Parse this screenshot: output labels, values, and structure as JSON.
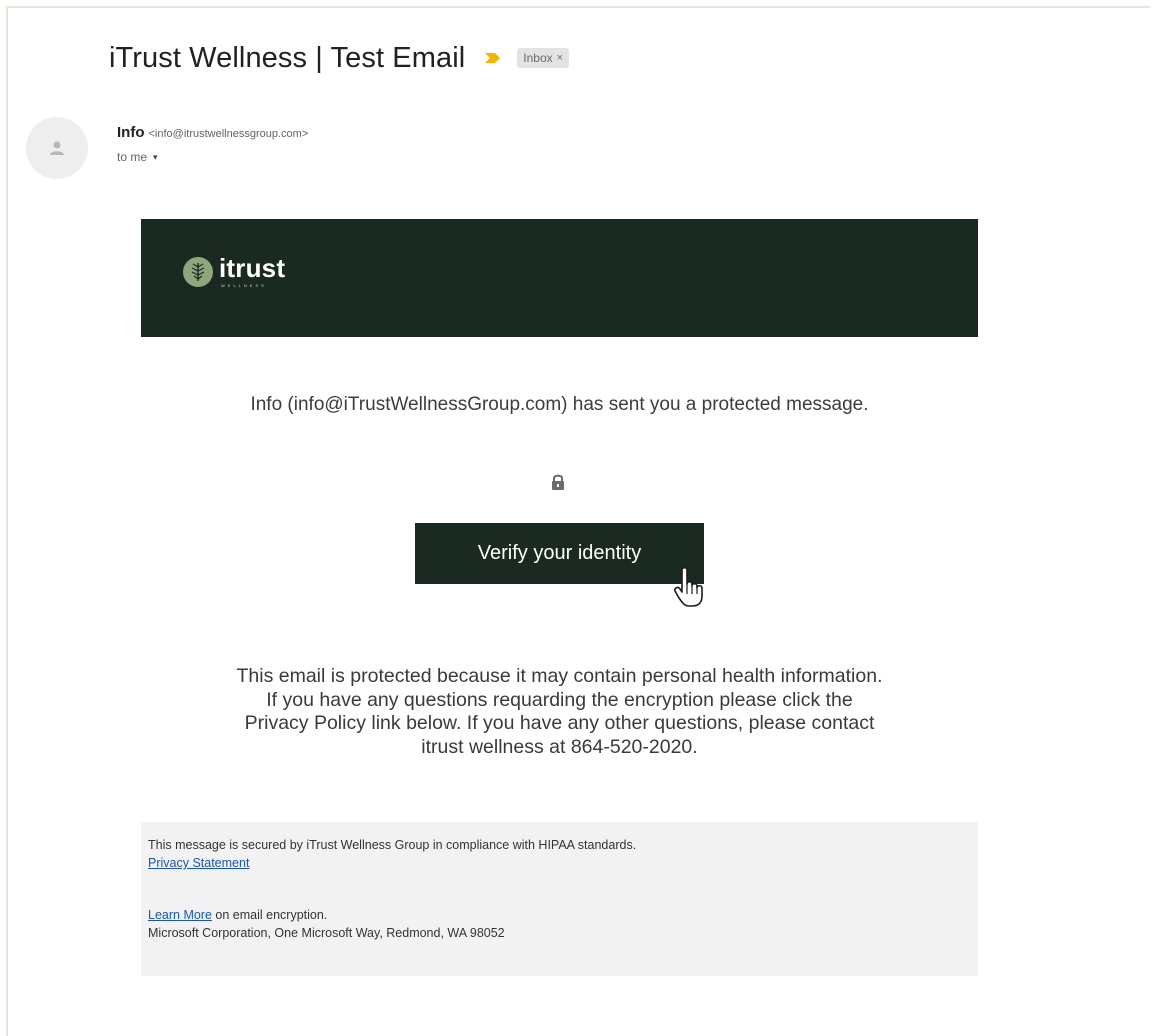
{
  "email": {
    "subject": "iTrust Wellness | Test Email",
    "label": "Inbox",
    "label_remove": "×",
    "sender_name": "Info",
    "sender_email": "<info@itrustwellnessgroup.com>",
    "recipient": "to me",
    "recipient_caret": "▾"
  },
  "banner": {
    "logo_text": "itrust",
    "logo_subtext": "WELLNESS",
    "background": "#1b2a21",
    "logo_color": "#8fa57b"
  },
  "message": {
    "sent_notice": "Info (info@iTrustWellnessGroup.com) has sent you a protected message.",
    "verify_button": "Verify your identity",
    "protection_line1": "This email is protected because it may contain personal health information.",
    "protection_line2": "If you have any questions requarding the encryption please click the",
    "protection_line3": "Privacy Policy link below. If you have any other questions, please contact",
    "protection_line4": "itrust wellness at 864-520-2020."
  },
  "footer": {
    "compliance": "This message is secured by iTrust Wellness Group in compliance with HIPAA standards.",
    "privacy_link": "Privacy Statement",
    "learn_more_link": "Learn More",
    "learn_more_suffix": " on email encryption.",
    "address": "Microsoft Corporation, One Microsoft Way, Redmond, WA 98052"
  },
  "icons": {
    "importance": "importance-marker-icon",
    "avatar": "person-icon",
    "lock": "lock-icon",
    "cursor": "hand-pointer-icon",
    "logo": "leaf-icon"
  },
  "colors": {
    "importance": "#f4b400",
    "link": "#1a55b8",
    "button": "#1b2a21"
  }
}
